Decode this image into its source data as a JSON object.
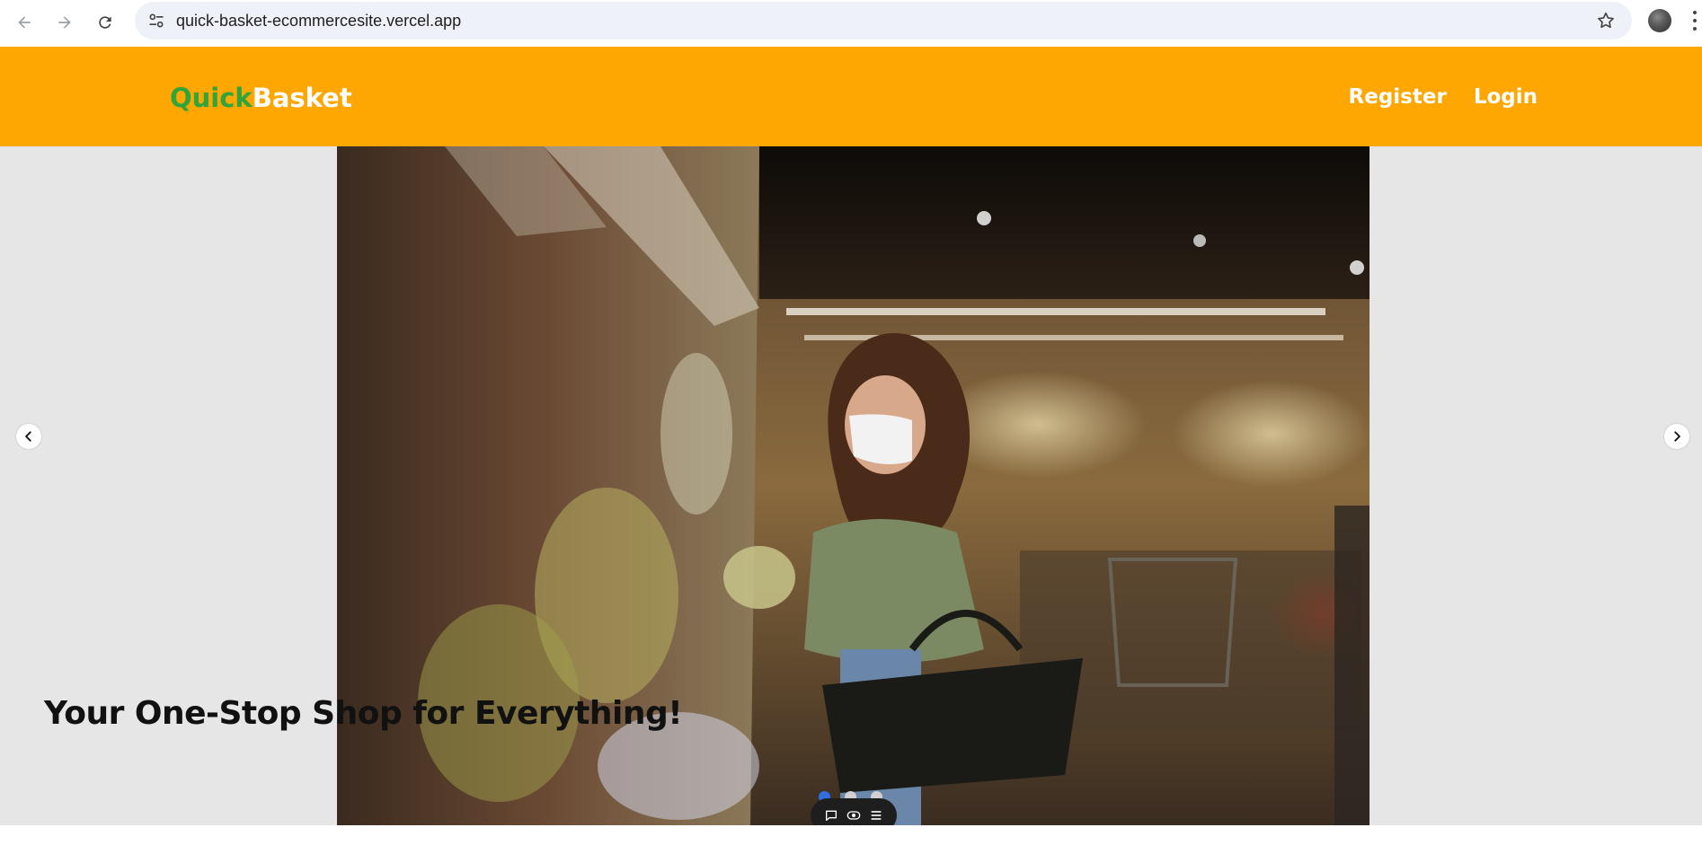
{
  "browser": {
    "url": "quick-basket-ecommercesite.vercel.app"
  },
  "header": {
    "brand_quick": "Quick",
    "brand_basket": "Basket",
    "nav": [
      {
        "label": "Register"
      },
      {
        "label": "Login"
      }
    ],
    "colors": {
      "background": "#fea602",
      "quick": "#2fa53c",
      "basket": "#ffffff"
    }
  },
  "hero": {
    "headline": "Your One-Stop Shop for Everything!",
    "active_slide": 1,
    "slide_count": 3
  }
}
